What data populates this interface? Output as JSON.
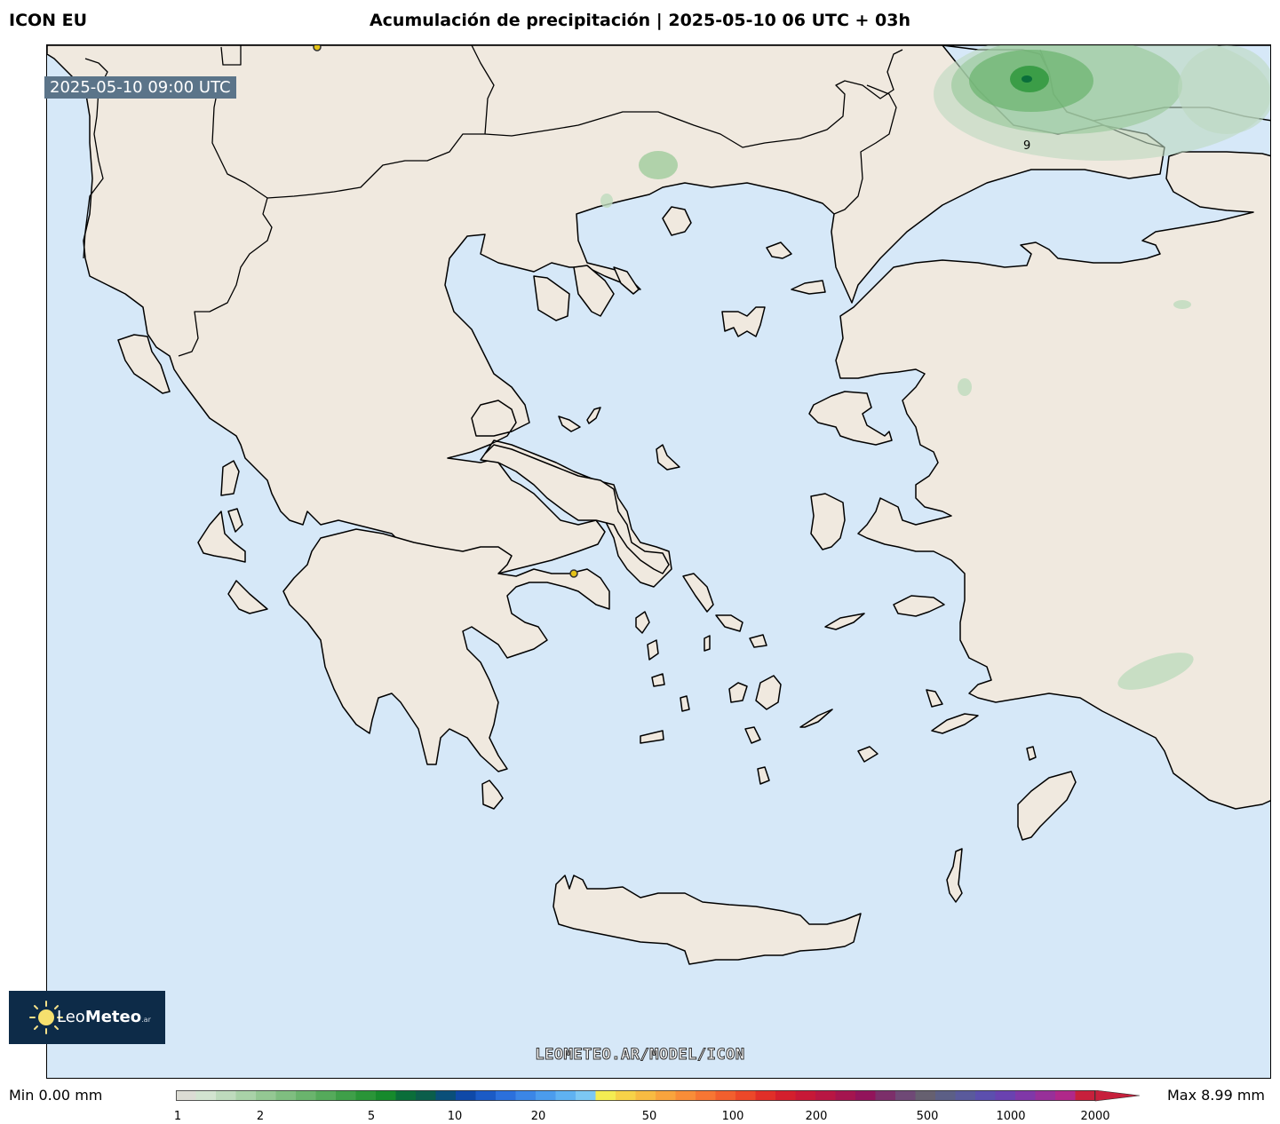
{
  "header": {
    "model": "ICON EU",
    "title": "Acumulación de precipitación | 2025-05-10 06 UTC + 03h"
  },
  "map": {
    "valid_time": "2025-05-10 09:00 UTC",
    "region": "Greece / Aegean Sea",
    "sea_color": "#d6e8f8",
    "land_color": "#f0e9df",
    "coast_color": "#000000",
    "contour_label": "9",
    "cities": [
      "city-marker-north",
      "athens-marker"
    ]
  },
  "branding": {
    "logo_name": "LeoMeteo",
    "logo_prefix": "Leo",
    "logo_bold": "Meteo",
    "logo_suffix": ".ar",
    "watermark": "LEOMETEO.AR/MODEL/ICON"
  },
  "legend": {
    "min_label": "Min 0.00 mm",
    "max_label": "Max 8.99 mm",
    "ticks": [
      "1",
      "2",
      "5",
      "10",
      "20",
      "50",
      "100",
      "200",
      "500",
      "1000",
      "2000"
    ],
    "colors": [
      "#dcdcd4",
      "#d2e4d0",
      "#bedbbd",
      "#a9d2a8",
      "#94c893",
      "#7fbe80",
      "#6ab46d",
      "#55aa5b",
      "#3f9f49",
      "#2a9538",
      "#168a2c",
      "#0a6e3a",
      "#0b5e4b",
      "#0a4f79",
      "#0f49a8",
      "#1b5bc6",
      "#2b70dc",
      "#3b86e6",
      "#4b9ced",
      "#5fb2f2",
      "#7cc8f4",
      "#f4ec52",
      "#f7d248",
      "#f8bb42",
      "#f9a43d",
      "#f98d38",
      "#f77633",
      "#f25f2e",
      "#ec4829",
      "#e12f28",
      "#d41f2d",
      "#c71837",
      "#b81643",
      "#a5154f",
      "#92145b",
      "#7c2f6a",
      "#6f4976",
      "#666070",
      "#5c5f86",
      "#5a5a9c",
      "#5c4fae",
      "#6a42b0",
      "#8038a8",
      "#983099",
      "#b0288a",
      "#c7203c"
    ]
  }
}
